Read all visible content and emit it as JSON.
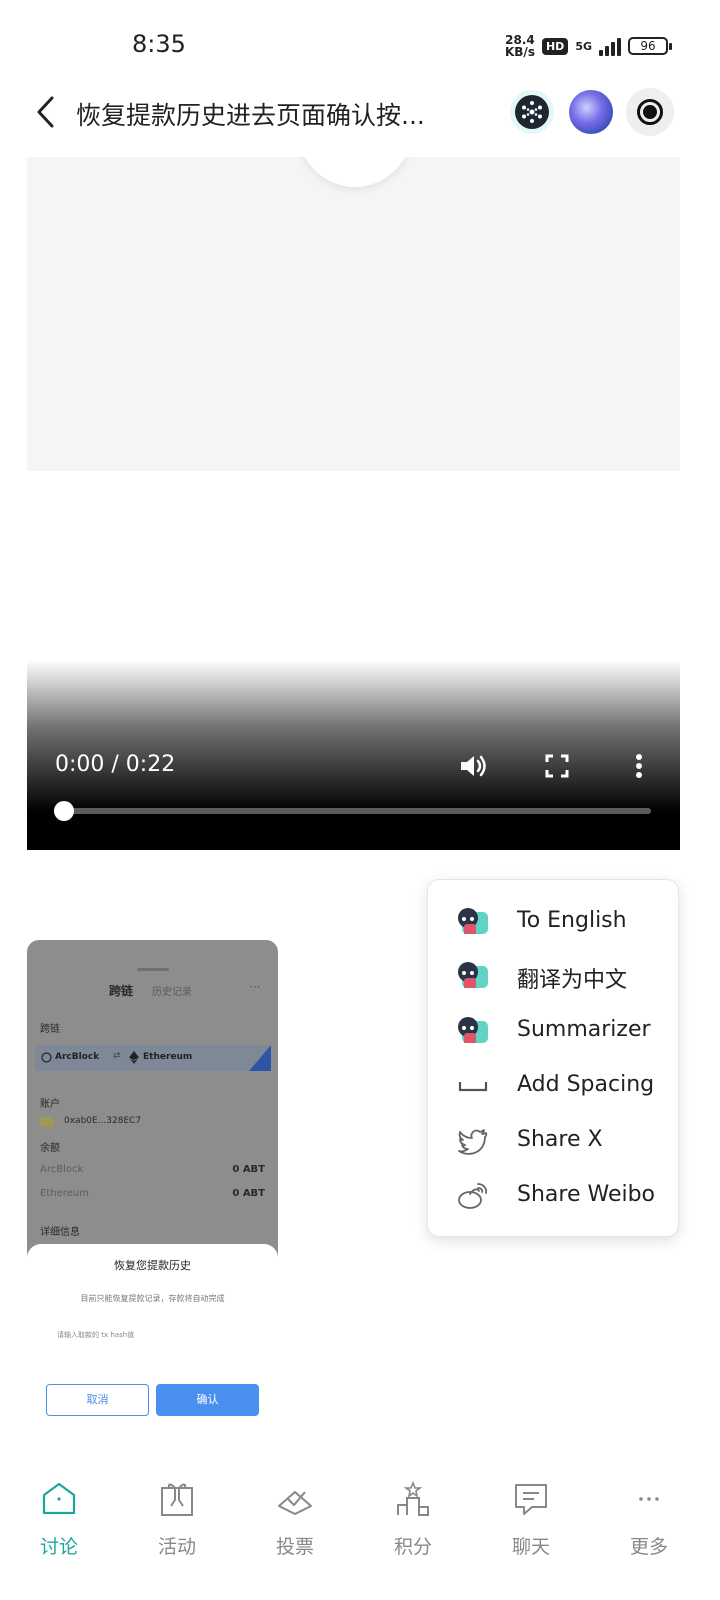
{
  "status_bar": {
    "time": "8:35",
    "net_speed_value": "28.4",
    "net_speed_unit": "KB/s",
    "hd_badge": "HD",
    "network": "5G",
    "battery": "96"
  },
  "header": {
    "title": "恢复提款历史进去页面确认按..."
  },
  "video": {
    "time": "0:00 / 0:22",
    "progress": 0
  },
  "thumbnail": {
    "tab_active": "跨链",
    "tab_inactive": "历史记录",
    "more": "···",
    "section_chain": "跨链",
    "chain_from": "ArcBlock",
    "chain_swap": "⇄",
    "chain_to": "Ethereum",
    "section_account": "账户",
    "address": "0xab0E...328EC7",
    "section_balance": "余额",
    "balances": [
      {
        "name": "ArcBlock",
        "value": "0 ABT"
      },
      {
        "name": "Ethereum",
        "value": "0 ABT"
      }
    ],
    "section_details": "详细信息",
    "sheet_title": "恢复您提款历史",
    "sheet_desc": "目前只能恢复提款记录，存款将自动完成",
    "sheet_placeholder": "请输入取款的 tx hash值",
    "cancel_label": "取消",
    "confirm_label": "确认"
  },
  "menu": {
    "items": [
      {
        "label": "To English",
        "icon": "robot-icon"
      },
      {
        "label": "翻译为中文",
        "icon": "robot-icon"
      },
      {
        "label": "Summarizer",
        "icon": "robot-icon"
      },
      {
        "label": "Add Spacing",
        "icon": "spacing-icon"
      },
      {
        "label": "Share X",
        "icon": "twitter-icon"
      },
      {
        "label": "Share Weibo",
        "icon": "weibo-icon"
      }
    ]
  },
  "bottom_nav": {
    "items": [
      {
        "label": "讨论",
        "icon": "home-icon",
        "active": true
      },
      {
        "label": "活动",
        "icon": "gift-icon",
        "active": false
      },
      {
        "label": "投票",
        "icon": "vote-icon",
        "active": false
      },
      {
        "label": "积分",
        "icon": "podium-icon",
        "active": false
      },
      {
        "label": "聊天",
        "icon": "chat-icon",
        "active": false
      },
      {
        "label": "更多",
        "icon": "more-icon",
        "active": false
      }
    ]
  },
  "colors": {
    "accent": "#1aa69a",
    "confirm_button": "#4a90f0"
  }
}
